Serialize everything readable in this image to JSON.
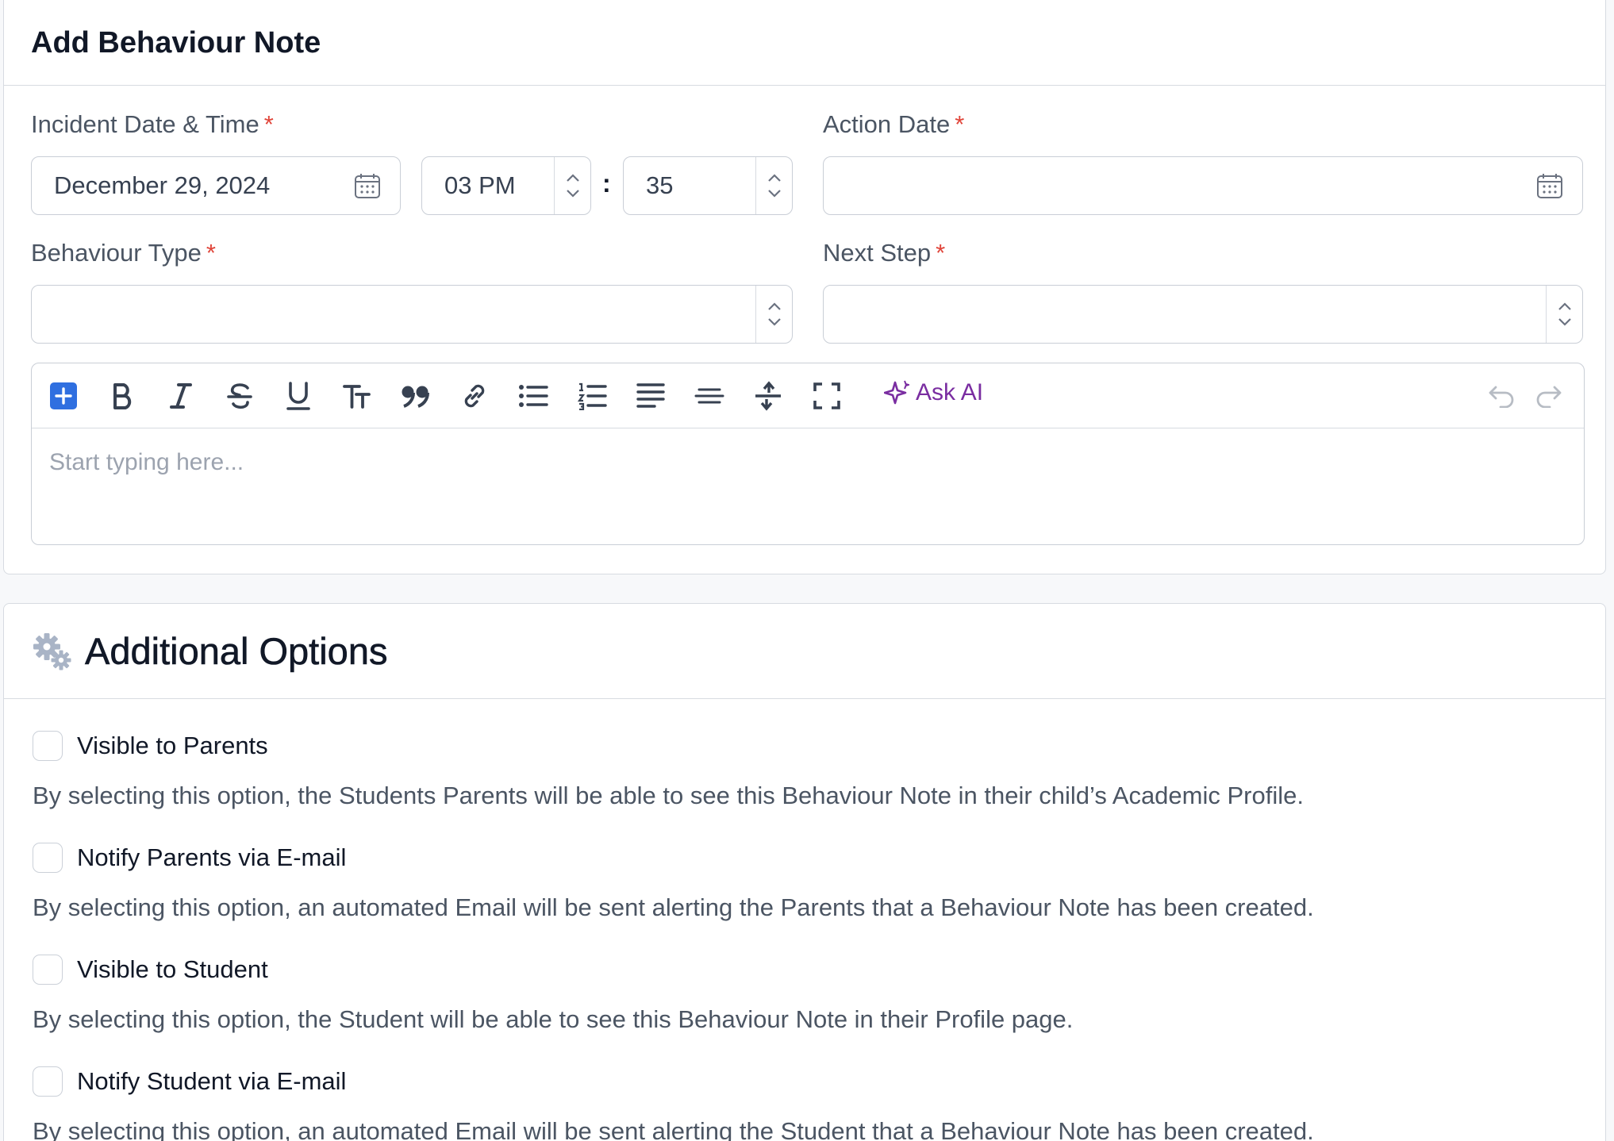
{
  "form": {
    "title": "Add Behaviour Note",
    "incident": {
      "label": "Incident Date & Time",
      "required": "*",
      "date_value": "December 29, 2024",
      "hour_value": "03 PM",
      "separator": ":",
      "minute_value": "35"
    },
    "action_date": {
      "label": "Action Date",
      "required": "*",
      "value": ""
    },
    "behaviour_type": {
      "label": "Behaviour Type",
      "required": "*",
      "value": ""
    },
    "next_step": {
      "label": "Next Step",
      "required": "*",
      "value": ""
    },
    "editor": {
      "placeholder": "Start typing here...",
      "ask_ai_label": "Ask AI",
      "toolbar_icons": [
        "plus-square-icon",
        "bold-icon",
        "italic-icon",
        "strikethrough-icon",
        "underline-icon",
        "font-size-icon",
        "quote-icon",
        "link-icon",
        "bullet-list-icon",
        "numbered-list-icon",
        "align-icon",
        "horizontal-rule-icon",
        "collapse-icon",
        "fullscreen-icon",
        "sparkle-icon",
        "undo-icon",
        "redo-icon"
      ]
    }
  },
  "options": {
    "title": "Additional Options",
    "items": [
      {
        "label": "Visible to Parents",
        "checked": false,
        "description": "By selecting this option, the Students Parents will be able to see this Behaviour Note in their child’s Academic Profile."
      },
      {
        "label": "Notify Parents via E-mail",
        "checked": false,
        "description": "By selecting this option, an automated Email will be sent alerting the Parents that a Behaviour Note has been created."
      },
      {
        "label": "Visible to Student",
        "checked": false,
        "description": "By selecting this option, the Student will be able to see this Behaviour Note in their Profile page."
      },
      {
        "label": "Notify Student via E-mail",
        "checked": false,
        "description": "By selecting this option, an automated Email will be sent alerting the Student that a Behaviour Note has been created."
      }
    ]
  },
  "colors": {
    "required": "#e0453a",
    "accent": "#2f6fe0",
    "ask_ai": "#7a2da1",
    "border": "#c9ced6"
  }
}
